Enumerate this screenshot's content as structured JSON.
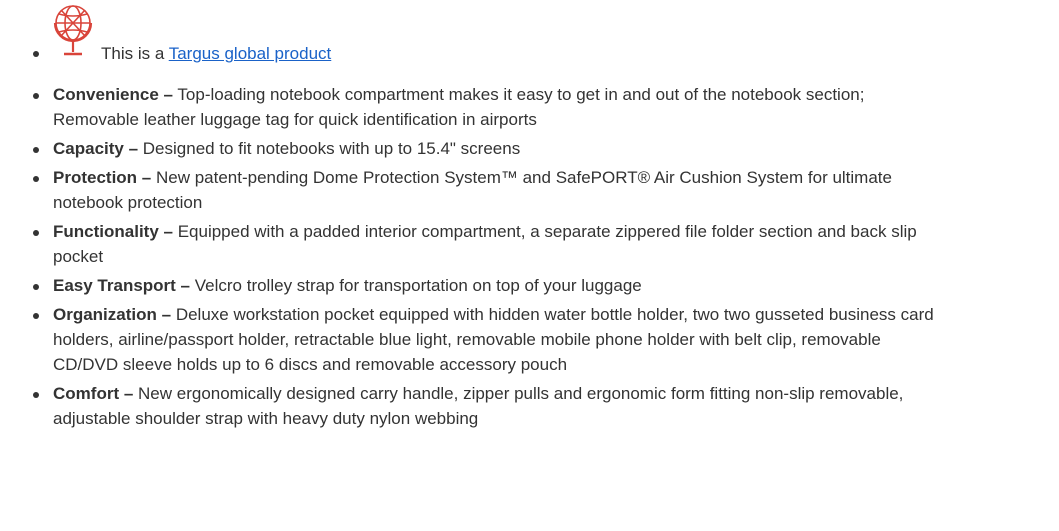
{
  "global": {
    "prefix": "This is a",
    "link_text": "Targus global product",
    "icon": "globe-icon",
    "icon_color": "#d9443a"
  },
  "features": [
    {
      "name": "Convenience –",
      "text": "Top-loading notebook compartment makes it easy to get in and out of the notebook section; Removable leather luggage tag for quick identification in airports"
    },
    {
      "name": "Capacity –",
      "text": "Designed to fit notebooks with up to 15.4\" screens"
    },
    {
      "name": "Protection –",
      "text": "New patent-pending Dome Protection System™ and SafePORT® Air Cushion System for ultimate notebook protection"
    },
    {
      "name": "Functionality –",
      "text": "Equipped with a padded interior compartment, a separate zippered file folder section and back slip pocket"
    },
    {
      "name": "Easy Transport –",
      "text": "Velcro trolley strap for transportation on top of your luggage"
    },
    {
      "name": "Organization –",
      "text": "Deluxe workstation pocket equipped with hidden water bottle holder, two two gusseted business card holders, airline/passport holder, retractable blue light, removable mobile phone holder with belt clip, removable CD/DVD sleeve holds up to 6 discs and removable accessory pouch"
    },
    {
      "name": "Comfort –",
      "text": "New ergonomically designed carry handle, zipper pulls and ergonomic form fitting non-slip removable, adjustable shoulder strap with heavy duty nylon webbing"
    }
  ]
}
